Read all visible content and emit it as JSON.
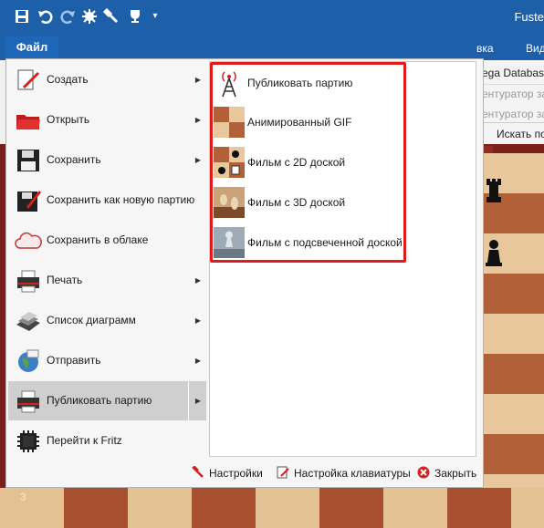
{
  "titlebar": {
    "app_title": "Fuste",
    "icons": [
      "save-icon",
      "undo-icon",
      "redo-icon",
      "engine-icon",
      "tools-icon",
      "trophy-icon",
      "customize-icon"
    ]
  },
  "ribbon": {
    "file_tab": "Файл",
    "tab_partial_1": "вка",
    "tab_partial_2": "Вид"
  },
  "background": {
    "database_label": "ega Databas",
    "line2": "ентуратор за б",
    "line3": "ентуратор за ч",
    "search_label": "Искать по",
    "rank_label": "3"
  },
  "menu": {
    "items": [
      {
        "label": "Создать",
        "icon": "new-document-icon",
        "has_submenu": true
      },
      {
        "label": "Открыть",
        "icon": "folder-icon",
        "has_submenu": true
      },
      {
        "label": "Сохранить",
        "icon": "floppy-icon",
        "has_submenu": true
      },
      {
        "label": "Сохранить как новую партию",
        "icon": "floppy-edit-icon",
        "has_submenu": false
      },
      {
        "label": "Сохранить в облаке",
        "icon": "cloud-icon",
        "has_submenu": false
      },
      {
        "label": "Печать",
        "icon": "printer-icon",
        "has_submenu": true
      },
      {
        "label": "Список диаграмм",
        "icon": "boards-icon",
        "has_submenu": true
      },
      {
        "label": "Отправить",
        "icon": "globe-icon",
        "has_submenu": true
      },
      {
        "label": "Публиковать партию",
        "icon": "publish-icon",
        "has_submenu": true,
        "active": true
      },
      {
        "label": "Перейти к Fritz",
        "icon": "chip-icon",
        "has_submenu": false
      }
    ]
  },
  "submenu": {
    "items": [
      {
        "label": "Публиковать партию",
        "icon": "antenna-icon"
      },
      {
        "label": "Анимированный GIF",
        "icon": "gif-board-icon"
      },
      {
        "label": "Фильм с 2D доской",
        "icon": "board-2d-icon"
      },
      {
        "label": "Фильм с 3D доской",
        "icon": "board-3d-icon"
      },
      {
        "label": "Фильм с подсвеченной доской",
        "icon": "lit-board-icon"
      }
    ]
  },
  "footer": {
    "settings_label": "Настройки",
    "keyboard_label": "Настройка клавиатуры",
    "close_label": "Закрыть"
  },
  "colors": {
    "titlebar": "#1d5fa8",
    "file_tab": "#1e66b8",
    "highlight": "#e01b1b",
    "active_item": "#cfcfcf"
  }
}
